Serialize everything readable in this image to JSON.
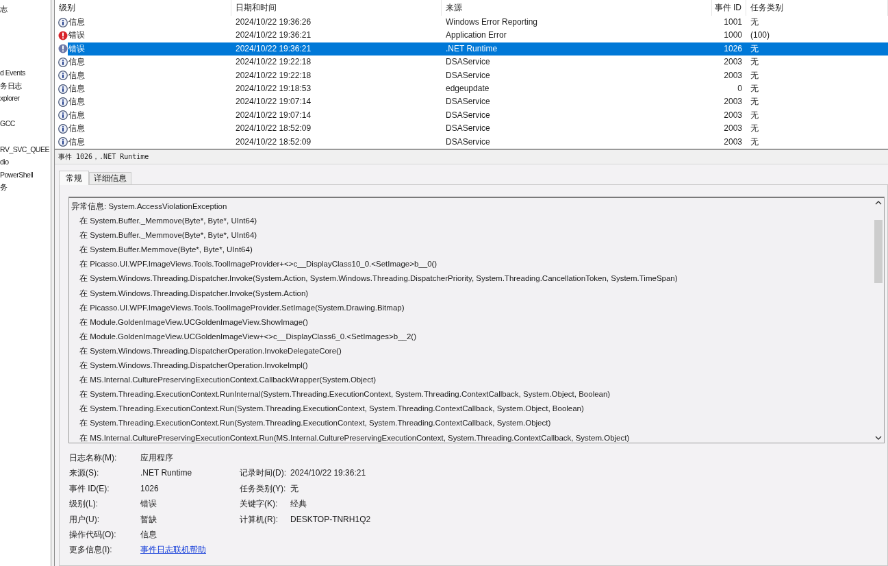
{
  "sidebar": {
    "items": [
      {
        "label": "志"
      },
      {
        "label": "d Events"
      },
      {
        "label": "务日志"
      },
      {
        "label": "xplorer"
      },
      {
        "label": "GCC"
      },
      {
        "label": "RV_SVC_QUEE"
      },
      {
        "label": "dio"
      },
      {
        "label": "PowerShell"
      },
      {
        "label": "务"
      }
    ]
  },
  "table": {
    "columns": [
      "级别",
      "日期和时间",
      "来源",
      "事件 ID",
      "任务类别"
    ],
    "rows": [
      {
        "kind": "info",
        "level": "信息",
        "date": "2024/10/22 19:36:26",
        "source": "Windows Error Reporting",
        "event_id": "1001",
        "task": "无",
        "selected": false
      },
      {
        "kind": "error",
        "level": "错误",
        "date": "2024/10/22 19:36:21",
        "source": "Application Error",
        "event_id": "1000",
        "task": "(100)",
        "selected": false
      },
      {
        "kind": "error",
        "level": "错误",
        "date": "2024/10/22 19:36:21",
        "source": ".NET Runtime",
        "event_id": "1026",
        "task": "无",
        "selected": true
      },
      {
        "kind": "info",
        "level": "信息",
        "date": "2024/10/22 19:22:18",
        "source": "DSAService",
        "event_id": "2003",
        "task": "无",
        "selected": false
      },
      {
        "kind": "info",
        "level": "信息",
        "date": "2024/10/22 19:22:18",
        "source": "DSAService",
        "event_id": "2003",
        "task": "无",
        "selected": false
      },
      {
        "kind": "info",
        "level": "信息",
        "date": "2024/10/22 19:18:53",
        "source": "edgeupdate",
        "event_id": "0",
        "task": "无",
        "selected": false
      },
      {
        "kind": "info",
        "level": "信息",
        "date": "2024/10/22 19:07:14",
        "source": "DSAService",
        "event_id": "2003",
        "task": "无",
        "selected": false
      },
      {
        "kind": "info",
        "level": "信息",
        "date": "2024/10/22 19:07:14",
        "source": "DSAService",
        "event_id": "2003",
        "task": "无",
        "selected": false
      },
      {
        "kind": "info",
        "level": "信息",
        "date": "2024/10/22 18:52:09",
        "source": "DSAService",
        "event_id": "2003",
        "task": "无",
        "selected": false
      },
      {
        "kind": "info",
        "level": "信息",
        "date": "2024/10/22 18:52:09",
        "source": "DSAService",
        "event_id": "2003",
        "task": "无",
        "selected": false
      }
    ]
  },
  "event_header": "事件 1026，.NET Runtime",
  "tabs": [
    {
      "label": "常规",
      "selected": true
    },
    {
      "label": "详细信息",
      "selected": false
    }
  ],
  "description": [
    "异常信息: System.AccessViolationException",
    "在 System.Buffer._Memmove(Byte*, Byte*, UInt64)",
    "在 System.Buffer._Memmove(Byte*, Byte*, UInt64)",
    "在 System.Buffer.Memmove(Byte*, Byte*, UInt64)",
    "在 Picasso.UI.WPF.ImageViews.Tools.ToolImageProvider+<>c__DisplayClass10_0.<SetImage>b__0()",
    "在 System.Windows.Threading.Dispatcher.Invoke(System.Action, System.Windows.Threading.DispatcherPriority, System.Threading.CancellationToken, System.TimeSpan)",
    "在 System.Windows.Threading.Dispatcher.Invoke(System.Action)",
    "在 Picasso.UI.WPF.ImageViews.Tools.ToolImageProvider.SetImage(System.Drawing.Bitmap)",
    "在 Module.GoldenImageView.UCGoldenImageView.ShowImage()",
    "在 Module.GoldenImageView.UCGoldenImageView+<>c__DisplayClass6_0.<SetImages>b__2()",
    "在 System.Windows.Threading.DispatcherOperation.InvokeDelegateCore()",
    "在 System.Windows.Threading.DispatcherOperation.InvokeImpl()",
    "在 MS.Internal.CulturePreservingExecutionContext.CallbackWrapper(System.Object)",
    "在 System.Threading.ExecutionContext.RunInternal(System.Threading.ExecutionContext, System.Threading.ContextCallback, System.Object, Boolean)",
    "在 System.Threading.ExecutionContext.Run(System.Threading.ExecutionContext, System.Threading.ContextCallback, System.Object, Boolean)",
    "在 System.Threading.ExecutionContext.Run(System.Threading.ExecutionContext, System.Threading.ContextCallback, System.Object)",
    "在 MS.Internal.CulturePreservingExecutionContext.Run(MS.Internal.CulturePreservingExecutionContext, System.Threading.ContextCallback, System.Object)"
  ],
  "details": [
    {
      "left": {
        "label": "日志名称(M):",
        "value": "应用程序",
        "kind": "text"
      }
    },
    {
      "left": {
        "label": "来源(S):",
        "value": ".NET Runtime",
        "kind": "text"
      },
      "right": {
        "label": "记录时间(D):",
        "value": "2024/10/22 19:36:21"
      }
    },
    {
      "left": {
        "label": "事件 ID(E):",
        "value": "1026",
        "kind": "text"
      },
      "right": {
        "label": "任务类别(Y):",
        "value": "无"
      }
    },
    {
      "left": {
        "label": "级别(L):",
        "value": "错误",
        "kind": "text"
      },
      "right": {
        "label": "关键字(K):",
        "value": "经典"
      }
    },
    {
      "left": {
        "label": "用户(U):",
        "value": "暂缺",
        "kind": "text"
      },
      "right": {
        "label": "计算机(R):",
        "value": "DESKTOP-TNRH1Q2"
      }
    },
    {
      "left": {
        "label": "操作代码(O):",
        "value": "信息",
        "kind": "text"
      }
    },
    {
      "left": {
        "label": "更多信息(I):",
        "value": "事件日志联机帮助",
        "kind": "link"
      }
    }
  ]
}
